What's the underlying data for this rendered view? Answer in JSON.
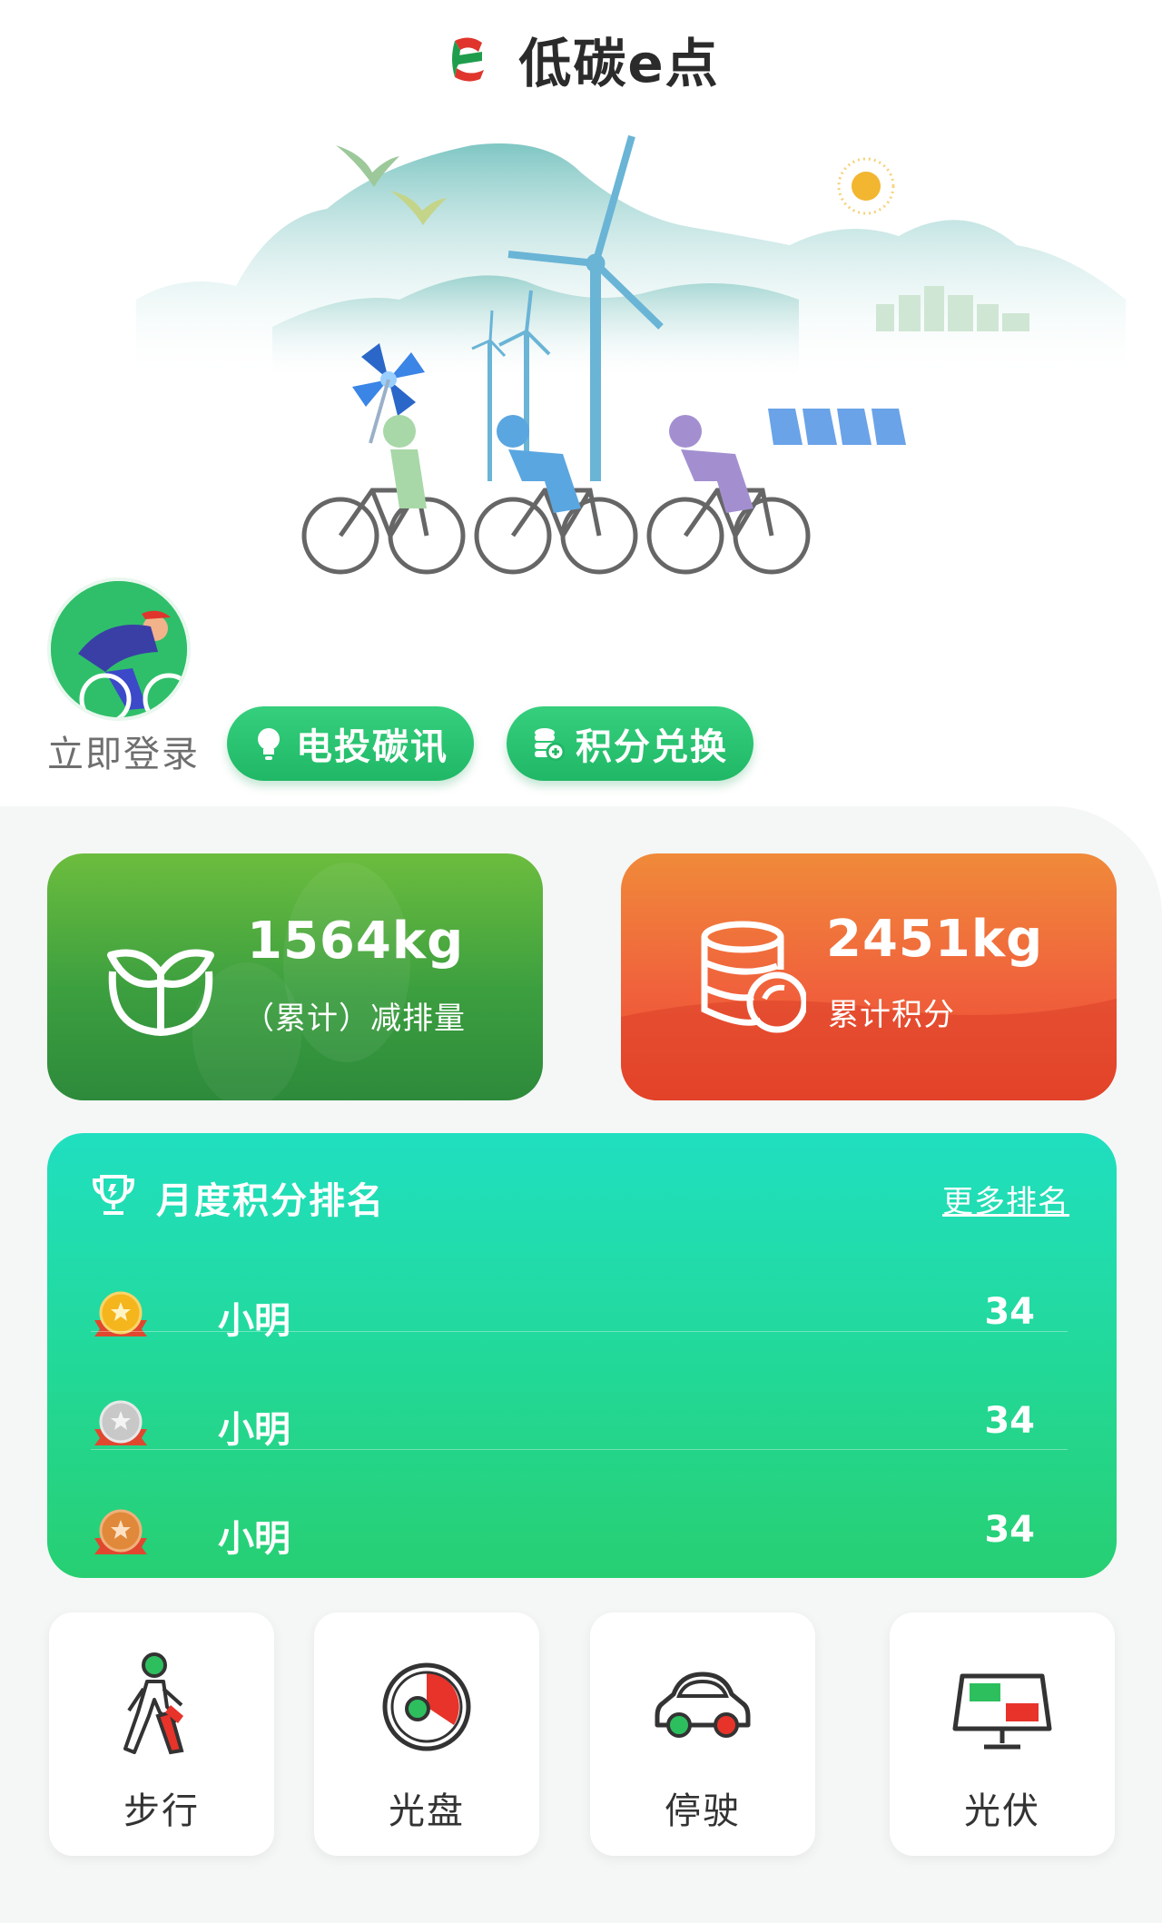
{
  "header": {
    "title": "低碳e点"
  },
  "profile": {
    "login_label": "立即登录"
  },
  "actions_top": {
    "news_label": "电投碳讯",
    "exchange_label": "积分兑换"
  },
  "stats": {
    "reduction": {
      "value": "1564kg",
      "label": "（累计）减排量"
    },
    "points": {
      "value": "2451kg",
      "label": "累计积分"
    }
  },
  "ranking": {
    "title": "月度积分排名",
    "more_label": "更多排名",
    "rows": [
      {
        "rank": 1,
        "name": "小明",
        "score": "34",
        "medal": "gold-medal"
      },
      {
        "rank": 2,
        "name": "小明",
        "score": "34",
        "medal": "silver-medal"
      },
      {
        "rank": 3,
        "name": "小明",
        "score": "34",
        "medal": "bronze-medal"
      }
    ]
  },
  "quick_actions": [
    {
      "label": "步行",
      "icon": "walking-icon"
    },
    {
      "label": "光盘",
      "icon": "clean-plate-icon"
    },
    {
      "label": "停驶",
      "icon": "car-icon"
    },
    {
      "label": "光伏",
      "icon": "solar-panel-icon"
    }
  ],
  "colors": {
    "brand_green": "#22b866",
    "stat_green": "#3c9f3f",
    "stat_orange": "#f0623c",
    "rank_teal": "#20dfc0"
  }
}
